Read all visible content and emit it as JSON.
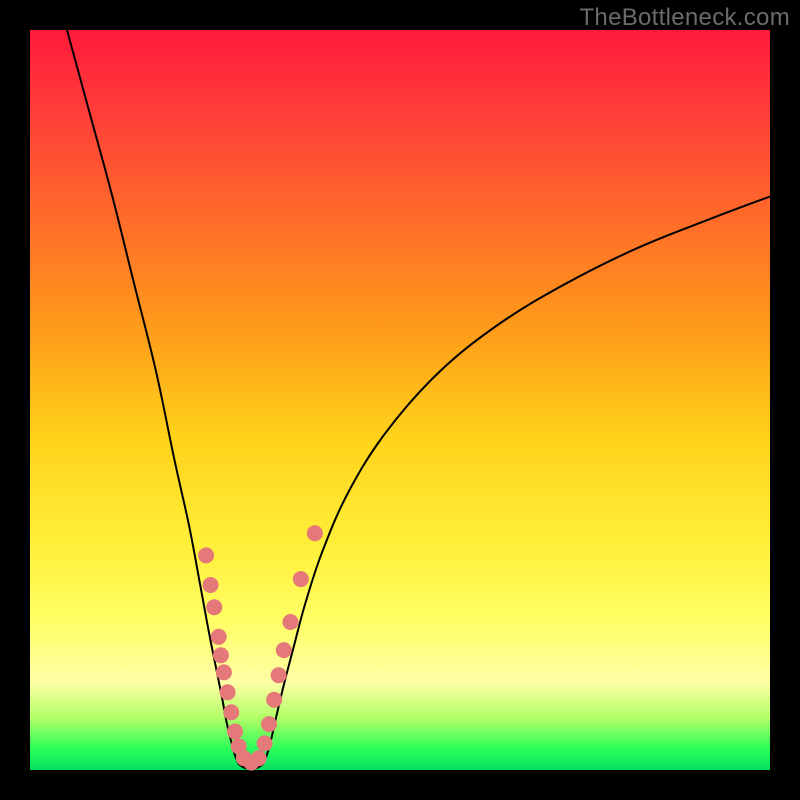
{
  "watermark": "TheBottleneck.com",
  "colors": {
    "frame": "#000000",
    "curve_stroke": "#000000",
    "marker_fill": "#e57878",
    "marker_stroke": "#cc5a5a"
  },
  "chart_data": {
    "type": "line",
    "title": "",
    "xlabel": "",
    "ylabel": "",
    "xlim": [
      0,
      100
    ],
    "ylim": [
      0,
      100
    ],
    "grid": false,
    "legend": false,
    "series": [
      {
        "name": "bottleneck-curve-left",
        "x": [
          5,
          8,
          11,
          14,
          17,
          19.5,
          21.5,
          23,
          24.2,
          25.2,
          26,
          26.6,
          27.2,
          27.7,
          28.2
        ],
        "y": [
          100,
          89,
          78,
          66,
          54,
          42,
          33,
          25,
          18.5,
          13.5,
          9.5,
          6.3,
          3.8,
          2,
          0.8
        ]
      },
      {
        "name": "bottleneck-curve-right",
        "x": [
          31.5,
          32,
          32.6,
          33.3,
          34.3,
          35.6,
          37.2,
          39.5,
          43,
          48,
          55,
          63,
          72,
          82,
          92,
          100
        ],
        "y": [
          0.8,
          2,
          4.2,
          7.3,
          11.5,
          16.5,
          22.5,
          29.5,
          37.5,
          45.5,
          53.5,
          60,
          65.5,
          70.5,
          74.5,
          77.5
        ]
      },
      {
        "name": "bottleneck-curve-floor",
        "x": [
          28.2,
          29.0,
          29.9,
          30.7,
          31.5
        ],
        "y": [
          0.8,
          0.3,
          0.2,
          0.3,
          0.8
        ]
      }
    ],
    "markers": [
      {
        "x": 23.8,
        "y": 29.0
      },
      {
        "x": 24.4,
        "y": 25.0
      },
      {
        "x": 24.9,
        "y": 22.0
      },
      {
        "x": 25.5,
        "y": 18.0
      },
      {
        "x": 25.8,
        "y": 15.5
      },
      {
        "x": 26.2,
        "y": 13.2
      },
      {
        "x": 26.7,
        "y": 10.5
      },
      {
        "x": 27.2,
        "y": 7.8
      },
      {
        "x": 27.7,
        "y": 5.2
      },
      {
        "x": 28.2,
        "y": 3.2
      },
      {
        "x": 28.9,
        "y": 1.6
      },
      {
        "x": 29.9,
        "y": 1.0
      },
      {
        "x": 30.9,
        "y": 1.6
      },
      {
        "x": 31.7,
        "y": 3.6
      },
      {
        "x": 32.3,
        "y": 6.2
      },
      {
        "x": 33.0,
        "y": 9.5
      },
      {
        "x": 33.6,
        "y": 12.8
      },
      {
        "x": 34.3,
        "y": 16.2
      },
      {
        "x": 35.2,
        "y": 20.0
      },
      {
        "x": 36.6,
        "y": 25.8
      },
      {
        "x": 38.5,
        "y": 32.0
      }
    ],
    "marker_radius": 8
  }
}
